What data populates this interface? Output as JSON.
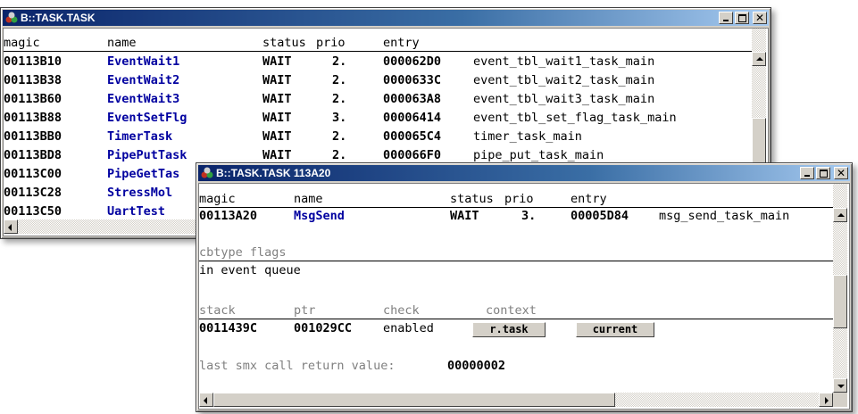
{
  "window1": {
    "title": "B::TASK.TASK",
    "columns": {
      "magic": "magic",
      "name": "name",
      "status": "status",
      "prio": "prio",
      "entry": "entry"
    },
    "rows": [
      {
        "magic": "00113B10",
        "name": "EventWait1",
        "status": "WAIT",
        "prio": "2.",
        "entry": "000062D0",
        "func": "event_tbl_wait1_task_main"
      },
      {
        "magic": "00113B38",
        "name": "EventWait2",
        "status": "WAIT",
        "prio": "2.",
        "entry": "0000633C",
        "func": "event_tbl_wait2_task_main"
      },
      {
        "magic": "00113B60",
        "name": "EventWait3",
        "status": "WAIT",
        "prio": "2.",
        "entry": "000063A8",
        "func": "event_tbl_wait3_task_main"
      },
      {
        "magic": "00113B88",
        "name": "EventSetFlg",
        "status": "WAIT",
        "prio": "3.",
        "entry": "00006414",
        "func": "event_tbl_set_flag_task_main"
      },
      {
        "magic": "00113BB0",
        "name": "TimerTask",
        "status": "WAIT",
        "prio": "2.",
        "entry": "000065C4",
        "func": "timer_task_main"
      },
      {
        "magic": "00113BD8",
        "name": "PipePutTask",
        "status": "WAIT",
        "prio": "2.",
        "entry": "000066F0",
        "func": "pipe_put_task_main"
      },
      {
        "magic": "00113C00",
        "name": "PipeGetTas",
        "status": "",
        "prio": "",
        "entry": "",
        "func": ""
      },
      {
        "magic": "00113C28",
        "name": "StressMol",
        "status": "",
        "prio": "",
        "entry": "",
        "func": ""
      },
      {
        "magic": "00113C50",
        "name": "UartTest",
        "status": "",
        "prio": "",
        "entry": "",
        "func": ""
      }
    ]
  },
  "window2": {
    "title": "B::TASK.TASK 113A20",
    "columns": {
      "magic": "magic",
      "name": "name",
      "status": "status",
      "prio": "prio",
      "entry": "entry"
    },
    "row": {
      "magic": "00113A20",
      "name": "MsgSend",
      "status": "WAIT",
      "prio": "3.",
      "entry": "00005D84",
      "func": "msg_send_task_main"
    },
    "cbtype_header": "cbtype flags",
    "cbtype_value": "in event queue",
    "stack_headers": {
      "stack": "stack",
      "ptr": "ptr",
      "check": "check",
      "context": "context"
    },
    "stack_values": {
      "stack": "0011439C",
      "ptr": "001029CC",
      "check": "enabled"
    },
    "buttons": {
      "rtask": "r.task",
      "current": "current"
    },
    "last_call_label": "last smx call return value:",
    "last_call_value": "00000002"
  },
  "icons": {
    "app": "trace32-icon",
    "minimize": "minimize-icon",
    "maximize": "maximize-icon",
    "close": "close-icon"
  }
}
